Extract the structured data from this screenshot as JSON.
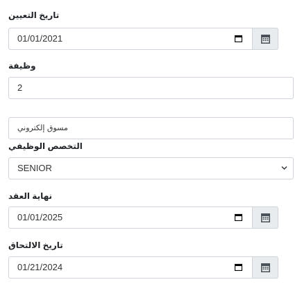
{
  "fields": {
    "appointment_date": {
      "label": "تاريخ التعيين",
      "value": "01/01/2021"
    },
    "job": {
      "label": "وظيفة",
      "value": "2"
    },
    "job_title_text": {
      "value": "مسوق إلكتروني"
    },
    "job_specialty": {
      "label": "التخصص الوظيفي",
      "value": "SENIOR"
    },
    "contract_end": {
      "label": "نهاية العقد",
      "value": "01/01/2025"
    },
    "joining_date": {
      "label": "تاريخ الالتحاق",
      "value": "01/21/2024"
    }
  },
  "icons": {
    "calendar": "calendar-icon",
    "addon_calendar": "calendar-grid-icon",
    "chevron": "chevron-down-icon"
  },
  "colors": {
    "border": "#ced4da",
    "addon_bg": "#e9ecef",
    "text": "#212529"
  }
}
